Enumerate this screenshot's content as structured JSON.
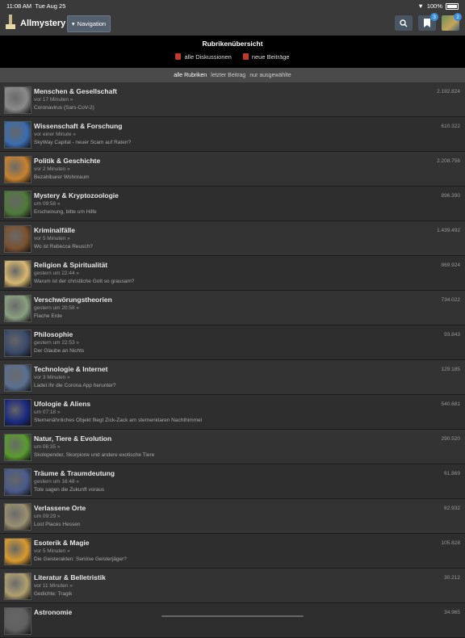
{
  "status": {
    "time": "11:08 AM",
    "date": "Tue Aug 25",
    "battery": "100%"
  },
  "topbar": {
    "app_name": "Allmystery",
    "nav_label": "Navigation",
    "bookmark_badge": "3",
    "avatar_badge": "2"
  },
  "header": {
    "title": "Rubrikenübersicht",
    "link_all": "alle Diskussionen",
    "link_new": "neue Beiträge"
  },
  "filters": {
    "all": "alle Rubriken",
    "last": "letzter Beitrag",
    "selected": "nur ausgewählte"
  },
  "colors": {
    "accent": "#3a8fd8",
    "header_bg": "#000000",
    "row_bg": "#2e2e2e"
  },
  "categories": [
    {
      "name": "Menschen & Gesellschaft",
      "time": "vor 17 Minuten »",
      "last": "Coronavirus (Sars-CoV-2)",
      "count": "2.192.824",
      "color": "#8a8a8a"
    },
    {
      "name": "Wissenschaft & Forschung",
      "time": "vor einer Minute »",
      "last": "SkyWay Capital - neuer Scam auf Raten?",
      "count": "610.322",
      "color": "#3b6db0"
    },
    {
      "name": "Politik & Geschichte",
      "time": "vor 2 Minuten »",
      "last": "Bezahlbarer Wohnraum",
      "count": "2.208.756",
      "color": "#c7822f"
    },
    {
      "name": "Mystery & Kryptozoologie",
      "time": "um 09:58 »",
      "last": "Erscheinung, bitte um Hilfe",
      "count": "896.390",
      "color": "#4f7a3a"
    },
    {
      "name": "Kriminalfälle",
      "time": "vor 5 Minuten »",
      "last": "Wo ist Rebecca Reusch?",
      "count": "1.439.492",
      "color": "#7a5230"
    },
    {
      "name": "Religion & Spiritualität",
      "time": "gestern um 22:44 »",
      "last": "Warum ist der christliche Gott so grausam?",
      "count": "869.924",
      "color": "#d8b870"
    },
    {
      "name": "Verschwörungstheorien",
      "time": "gestern um 20:58 »",
      "last": "Flache Erde",
      "count": "734.022",
      "color": "#8aa080"
    },
    {
      "name": "Philosophie",
      "time": "gestern um 22:53 »",
      "last": "Der Glaube an Nichts",
      "count": "93.843",
      "color": "#3a4a6a"
    },
    {
      "name": "Technologie & Internet",
      "time": "vor 3 Minuten »",
      "last": "Ladet ihr die Corona App herunter?",
      "count": "129.185",
      "color": "#5a7090"
    },
    {
      "name": "Ufologie & Aliens",
      "time": "um 07:18 »",
      "last": "Sternenähnliches Objekt fliegt Zick-Zack am sternenklaren Nachthimmel",
      "count": "540.681",
      "color": "#1a2a80"
    },
    {
      "name": "Natur, Tiere & Evolution",
      "time": "um 06:35 »",
      "last": "Skolopender, Skorpione und andere exotische Tiere",
      "count": "290.520",
      "color": "#5a9a30"
    },
    {
      "name": "Träume & Traumdeutung",
      "time": "gestern um 16:48 »",
      "last": "Tote sagen die Zukunft voraus",
      "count": "61.869",
      "color": "#4a5a8a"
    },
    {
      "name": "Verlassene Orte",
      "time": "um 09:29 »",
      "last": "Lost Places Hessen",
      "count": "62.932",
      "color": "#9a9070"
    },
    {
      "name": "Esoterik & Magie",
      "time": "vor 5 Minuten »",
      "last": "Die Geisterakten: Seriöse Geisterjäger?",
      "count": "105.828",
      "color": "#d89a30"
    },
    {
      "name": "Literatur & Belletristik",
      "time": "vor 11 Minuten »",
      "last": "Gedichte: Tragik",
      "count": "30.212",
      "color": "#b0a070"
    },
    {
      "name": "Astronomie",
      "time": "",
      "last": "",
      "count": "34.965",
      "color": "#606060"
    }
  ]
}
